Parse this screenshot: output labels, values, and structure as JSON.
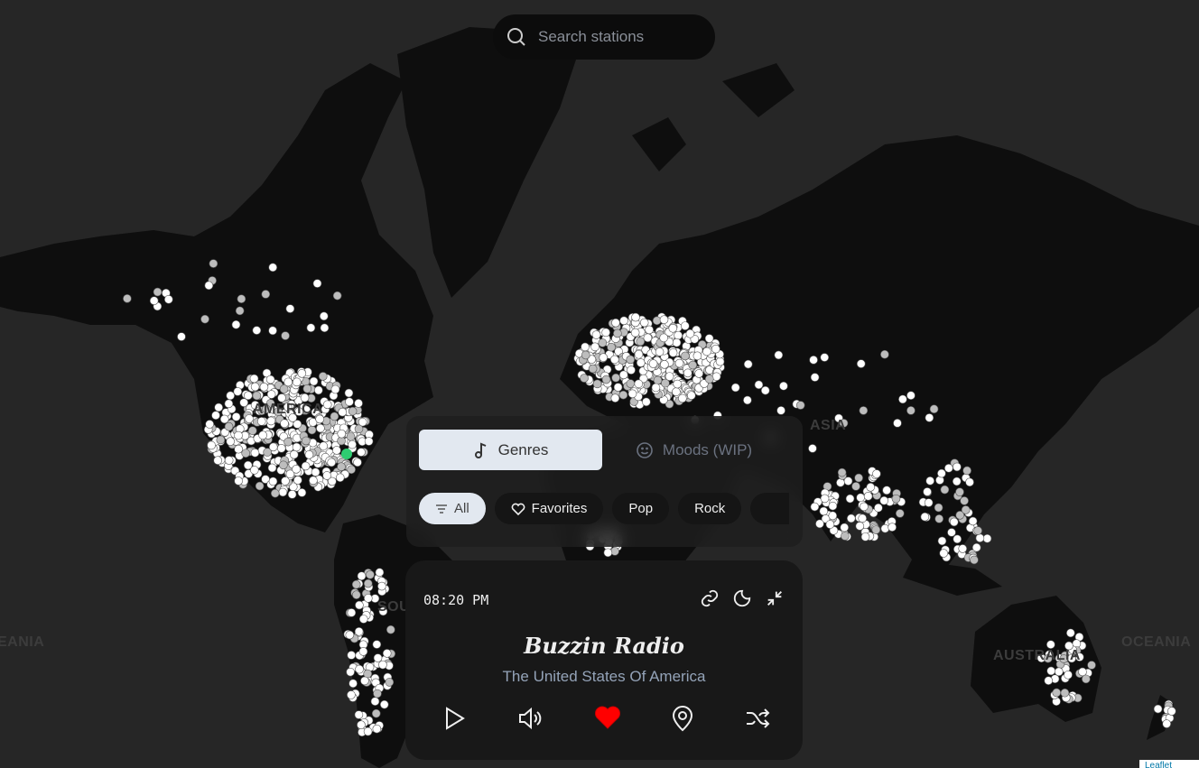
{
  "search": {
    "placeholder": "Search stations"
  },
  "map": {
    "labels": [
      "AMERICA",
      "ASIA",
      "AUSTRALIA",
      "OCEANIA",
      "OCEANIA",
      "SOUTH"
    ],
    "land_color": "#0e0e0e",
    "water_color": "#262626",
    "station_color": "#ffffff",
    "selected_station_color": "#2ecc71",
    "attribution": "Leaflet"
  },
  "genres_panel": {
    "tabs": [
      {
        "label": "Genres",
        "icon": "music-note-icon",
        "active": true
      },
      {
        "label": "Moods (WIP)",
        "icon": "smiley-icon",
        "active": false
      }
    ],
    "chips": [
      {
        "label": "All",
        "icon": "filter-icon",
        "active": true
      },
      {
        "label": "Favorites",
        "icon": "heart-outline-icon",
        "active": false
      },
      {
        "label": "Pop",
        "active": false
      },
      {
        "label": "Rock",
        "active": false
      },
      {
        "label": "",
        "active": false
      }
    ]
  },
  "player": {
    "time": "08:20 PM",
    "station_name": "Buzzin Radio",
    "country": "The United States Of America",
    "favorite_color": "#ff0000"
  }
}
